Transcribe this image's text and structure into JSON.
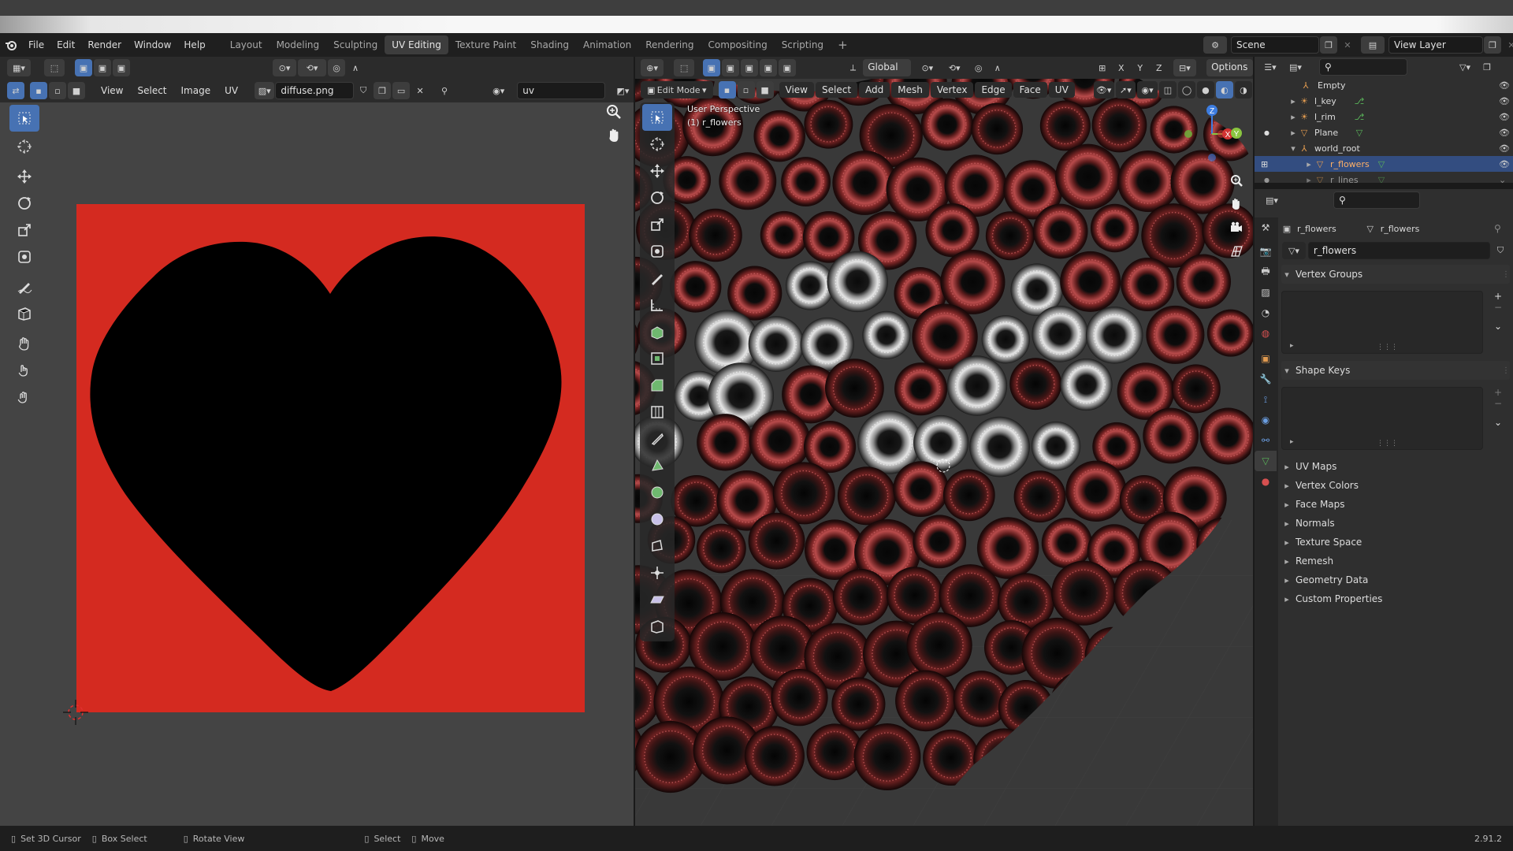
{
  "topbar": {
    "menus": [
      "File",
      "Edit",
      "Render",
      "Window",
      "Help"
    ],
    "workspaces": [
      "Layout",
      "Modeling",
      "Sculpting",
      "UV Editing",
      "Texture Paint",
      "Shading",
      "Animation",
      "Rendering",
      "Compositing",
      "Scripting"
    ],
    "active_workspace": "UV Editing",
    "add_tab": "+",
    "scene": "Scene",
    "view_layer": "View Layer"
  },
  "uv_editor": {
    "menus": [
      "View",
      "Select",
      "Image",
      "UV"
    ],
    "image_name": "diffuse.png",
    "uv_map": "uv",
    "texture_colors": {
      "background": "#d42a20",
      "heart": "#000000"
    }
  },
  "viewport": {
    "mode": "Edit Mode",
    "menus": [
      "View",
      "Select",
      "Add",
      "Mesh",
      "Vertex",
      "Edge",
      "Face",
      "UV"
    ],
    "orientation": "Global",
    "options": "Options",
    "overlay_line1": "User Perspective",
    "overlay_line2": "(1) r_flowers",
    "axes": {
      "x": "X",
      "y": "Y",
      "z": "Z"
    }
  },
  "outliner": {
    "rows": [
      {
        "name": "Empty",
        "icon": "empty-icon",
        "selected": false
      },
      {
        "name": "l_key",
        "icon": "light-icon",
        "selected": false
      },
      {
        "name": "l_rim",
        "icon": "light-icon",
        "selected": false
      },
      {
        "name": "Plane",
        "icon": "mesh-icon",
        "selected": false
      },
      {
        "name": "world_root",
        "icon": "empty-icon",
        "selected": false
      },
      {
        "name": "r_flowers",
        "icon": "mesh-icon",
        "selected": true
      },
      {
        "name": "r_lines",
        "icon": "mesh-icon",
        "selected": false
      }
    ]
  },
  "properties": {
    "object_name": "r_flowers",
    "mesh_name": "r_flowers",
    "data_field": "r_flowers",
    "open_panels": [
      "Vertex Groups",
      "Shape Keys"
    ],
    "closed_panels": [
      "UV Maps",
      "Vertex Colors",
      "Face Maps",
      "Normals",
      "Texture Space",
      "Remesh",
      "Geometry Data",
      "Custom Properties"
    ]
  },
  "statusbar": {
    "items": [
      "Set 3D Cursor",
      "Box Select",
      "Rotate View",
      "Select",
      "Move"
    ],
    "version": "2.91.2"
  },
  "colors": {
    "accent": "#4772b3",
    "selection_row": "#334d80"
  }
}
